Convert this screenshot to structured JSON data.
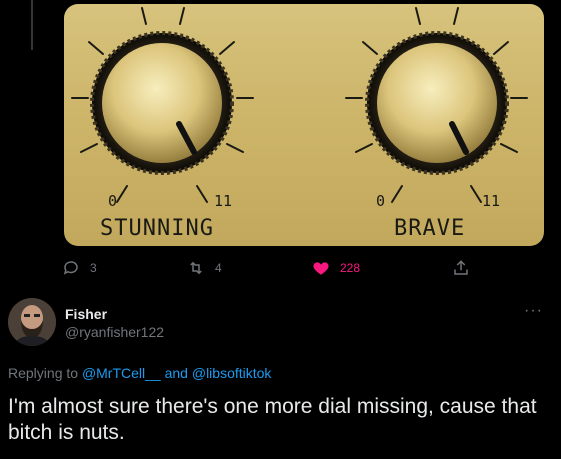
{
  "media": {
    "left_knob": {
      "label": "STUNNING",
      "min": "0",
      "max": "11",
      "level": 0.86
    },
    "right_knob": {
      "label": "BRAVE",
      "min": "0",
      "max": "11",
      "level": 0.86
    },
    "colors": {
      "panel": "#cdb56a",
      "knob": "#e2cf86",
      "ink": "#1a1a14"
    }
  },
  "actions": {
    "reply_count": "3",
    "retweet_count": "4",
    "like_count": "228",
    "like_color": "#f91880",
    "icons": [
      "reply-icon",
      "retweet-icon",
      "heart-icon",
      "share-icon"
    ]
  },
  "reply": {
    "name": "Fisher",
    "handle": "@ryanfisher122",
    "more_label": "···",
    "replying_prefix": "Replying to",
    "mention_1": "@MrTCell__",
    "conjunction": "and",
    "mention_2": "@libsoftiktok",
    "text": "I'm almost sure there's one more dial missing, cause that bitch is nuts."
  }
}
